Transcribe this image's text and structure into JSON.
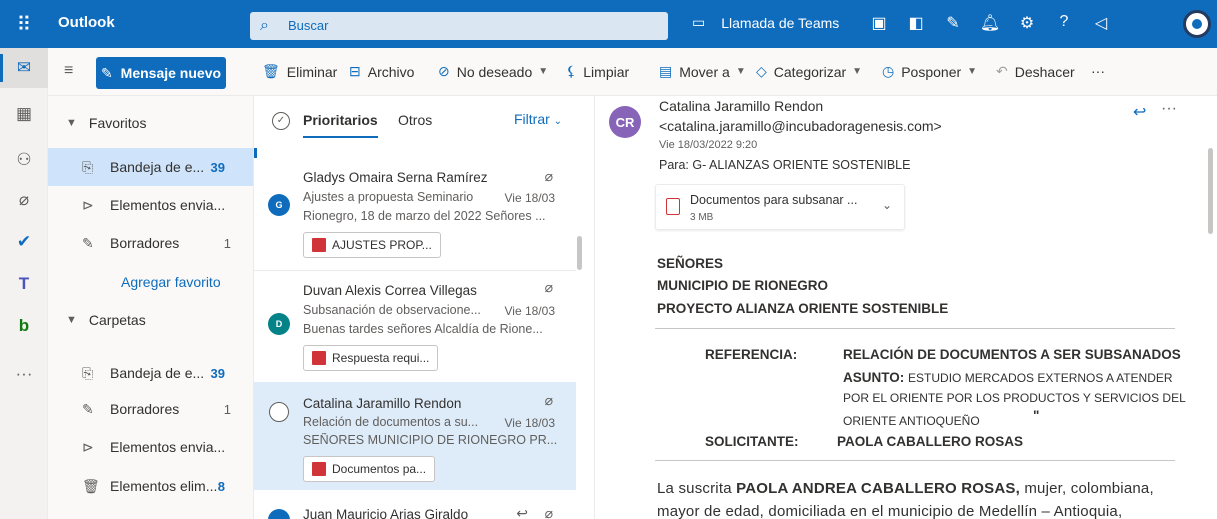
{
  "topbar": {
    "app_title": "Outlook",
    "search_placeholder": "Buscar",
    "teams_call": "Llamada de Teams"
  },
  "commands": {
    "new_mail": "Mensaje nuevo",
    "delete": "Eliminar",
    "archive": "Archivo",
    "junk": "No deseado",
    "sweep": "Limpiar",
    "move": "Mover a",
    "categorize": "Categorizar",
    "snooze": "Posponer",
    "undo": "Deshacer",
    "more": "···"
  },
  "folders": {
    "favorites_label": "Favoritos",
    "folders_label": "Carpetas",
    "add_favorite": "Agregar favorito",
    "favorites": [
      {
        "name": "Bandeja de e...",
        "count": "39"
      },
      {
        "name": "Elementos envia...",
        "count": ""
      },
      {
        "name": "Borradores",
        "count": "1"
      }
    ],
    "all": [
      {
        "name": "Bandeja de e...",
        "count": "39"
      },
      {
        "name": "Borradores",
        "count": "1"
      },
      {
        "name": "Elementos envia...",
        "count": ""
      },
      {
        "name": "Elementos elim...",
        "count": "8"
      }
    ]
  },
  "list": {
    "tab_focused": "Prioritarios",
    "tab_other": "Otros",
    "filter": "Filtrar",
    "messages": [
      {
        "initial": "G",
        "sender": "Gladys Omaira Serna Ramírez",
        "subject": "Ajustes a propuesta Seminario",
        "date": "Vie 18/03",
        "preview": "Rionegro, 18 de marzo del 2022 Señores ...",
        "attachment": "AJUSTES PROP...",
        "avatar_color": "#0f6cbd"
      },
      {
        "initial": "D",
        "sender": "Duvan Alexis Correa Villegas",
        "subject": "Subsanación de observacione...",
        "date": "Vie 18/03",
        "preview": "Buenas tardes señores Alcaldía de Rione...",
        "attachment": "Respuesta requi...",
        "avatar_color": "#038387"
      },
      {
        "initial": "",
        "sender": "Catalina Jaramillo Rendon",
        "subject": "Relación de documentos a su...",
        "date": "Vie 18/03",
        "preview": "SEÑORES MUNICIPIO DE RIONEGRO PR...",
        "attachment": "Documentos pa...",
        "avatar_color": ""
      },
      {
        "initial": "",
        "sender": "Juan Mauricio Arias Giraldo",
        "subject": "",
        "date": "",
        "preview": "",
        "attachment": "",
        "avatar_color": "#0f6cbd"
      }
    ]
  },
  "reading": {
    "sender_initials": "CR",
    "sender_name": "Catalina Jaramillo Rendon",
    "sender_email": "<catalina.jaramillo@incubadoragenesis.com>",
    "date": "Vie 18/03/2022 9:20",
    "to": "Para:  G- ALIANZAS ORIENTE SOSTENIBLE",
    "attachment_name": "Documentos para subsanar ...",
    "attachment_size": "3 MB",
    "body": {
      "line1": "SEÑORES",
      "line2": "MUNICIPIO DE RIONEGRO",
      "line3": "PROYECTO ALIANZA ORIENTE SOSTENIBLE",
      "ref_label": "REFERENCIA:",
      "ref_value": "RELACIÓN DE DOCUMENTOS A SER SUBSANADOS",
      "asunto_label": "ASUNTO:",
      "asunto_1": "ESTUDIO MERCADOS EXTERNOS A ATENDER",
      "asunto_2": "POR EL ORIENTE POR LOS PRODUCTOS Y SERVICIOS DEL",
      "asunto_3": "ORIENTE ANTIOQUEÑO",
      "asunto_quote": "\"",
      "sol_label": "SOLICITANTE:",
      "sol_value": "PAOLA CABALLERO ROSAS",
      "p1_a": "La suscrita ",
      "p1_b": "PAOLA ANDREA CABALLERO ROSAS,",
      "p1_c": " mujer, colombiana,",
      "p2": "mayor de edad, domiciliada en el municipio de Medellín – Antioquia,"
    }
  }
}
